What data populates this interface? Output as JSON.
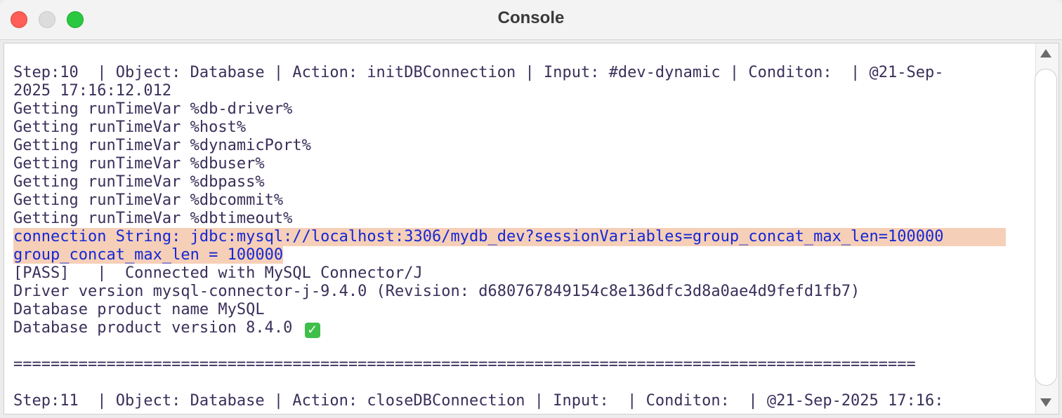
{
  "window": {
    "title": "Console"
  },
  "console": {
    "lines": [
      "Step:10  | Object: Database | Action: initDBConnection | Input: #dev-dynamic | Conditon:  | @21-Sep-",
      "2025 17:16:12.012",
      "Getting runTimeVar %db-driver%",
      "Getting runTimeVar %host%",
      "Getting runTimeVar %dynamicPort%",
      "Getting runTimeVar %dbuser%",
      "Getting runTimeVar %dbpass%",
      "Getting runTimeVar %dbcommit%",
      "Getting runTimeVar %dbtimeout%",
      "connection String: jdbc:mysql://localhost:3306/mydb_dev?sessionVariables=group_concat_max_len=100000",
      "group_concat_max_len = 100000",
      "[PASS]   |  Connected with MySQL Connector/J",
      "Driver version mysql-connector-j-9.4.0 (Revision: d680767849154c8e136dfc3d8a0ae4d9fefd1fb7)",
      "Database product name MySQL",
      "Database product version 8.4.0",
      "",
      "=================================================================================================",
      "",
      "Step:11  | Object: Database | Action: closeDBConnection | Input:  | Conditon:  | @21-Sep-2025 17:16:"
    ],
    "check_glyph": "✓",
    "colors": {
      "text": "#3b2f5a",
      "highlight_bg": "#f6cfb8",
      "highlight_text": "#1428d6"
    }
  }
}
